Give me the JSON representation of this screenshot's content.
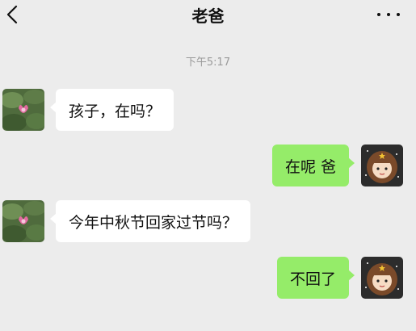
{
  "header": {
    "title": "老爸"
  },
  "chat": {
    "timestamp": "下午5:17",
    "messages": [
      {
        "side": "in",
        "text": "孩子，在吗？"
      },
      {
        "side": "out",
        "text": "在呢 爸"
      },
      {
        "side": "in",
        "text": "今年中秋节回家过节吗？"
      },
      {
        "side": "out",
        "text": "不回了"
      }
    ]
  },
  "colors": {
    "background": "#ececec",
    "incoming_bubble": "#ffffff",
    "outgoing_bubble": "#95ec69"
  },
  "icons": {
    "back": "chevron-left-icon",
    "more": "more-dots-icon"
  }
}
